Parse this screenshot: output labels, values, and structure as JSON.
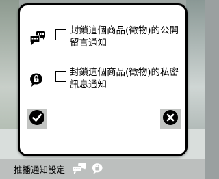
{
  "dialog": {
    "options": [
      {
        "label": "封鎖這個商品(徵物)的公開留言通知",
        "icon": "public-comment-icon",
        "checked": false
      },
      {
        "label": "封鎖這個商品(徵物)的私密訊息通知",
        "icon": "private-message-icon",
        "checked": false
      }
    ],
    "confirm_icon": "check-circle-icon",
    "cancel_icon": "close-circle-icon"
  },
  "bottom_bar": {
    "title": "推播通知設定",
    "icons": [
      "public-comment-icon",
      "private-message-icon"
    ]
  }
}
